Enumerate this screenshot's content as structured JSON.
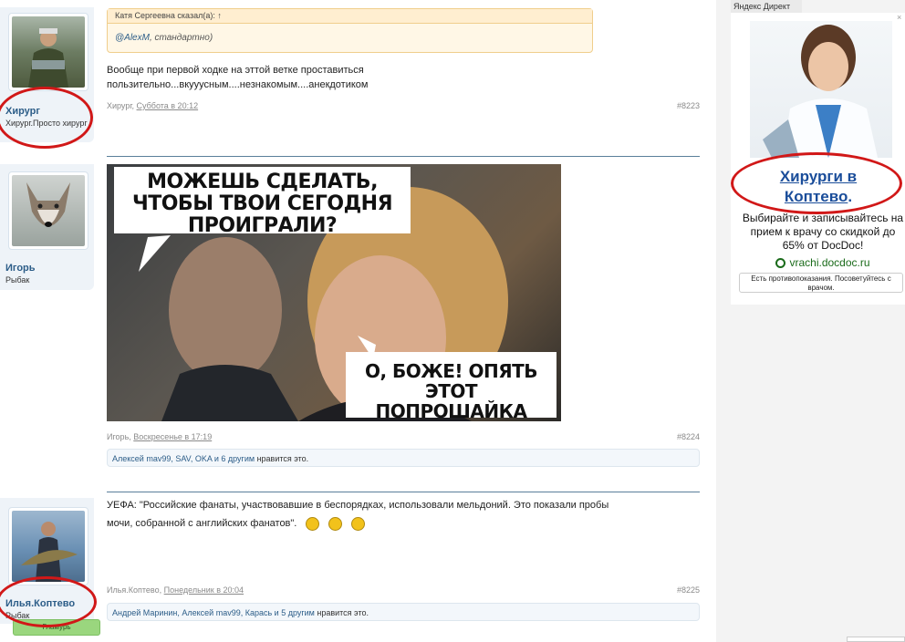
{
  "posts": [
    {
      "user": "Хирург",
      "user_title": "Хирург.Просто хирург",
      "quote_author": "Катя Сергеевна сказал(а): ↑",
      "quote_mention": "@AlexM",
      "quote_text": ", стандартно)",
      "message_line1": "Вообще при первой ходке на эттой ветке проставиться",
      "message_line2": "пользительно...вкууусным....незнакомым....анекдотиком",
      "meta_author": "Хирург, ",
      "meta_time": "Суббота в 20:12",
      "number": "#8223"
    },
    {
      "user": "Игорь",
      "user_title": "Рыбак",
      "meme_top": "МОЖЕШЬ СДЕЛАТЬ, ЧТОБЫ ТВОИ СЕГОДНЯ ПРОИГРАЛИ?",
      "meme_bottom": "О, БОЖЕ! ОПЯТЬ ЭТОТ ПОПРОШАЙКА",
      "meta_author": "Игорь, ",
      "meta_time": "Воскресенье в 17:19",
      "number": "#8224",
      "likes_names": "Алексей mav99, SAV, OKA и 6 другим",
      "likes_suffix": " нравится это."
    },
    {
      "user": "Илья.Коптево",
      "user_title": "Рыбак",
      "badge": "Гламурь",
      "message_line1": "УЕФА: \"Российские фанаты, участвовавшие в беспорядках, использовали мельдоний. Это показали пробы",
      "message_line2": "мочи, собранной с английских фанатов\".",
      "meta_author": "Илья.Коптево, ",
      "meta_time": "Понедельник в 20:04",
      "number": "#8225",
      "likes_names": "Андрей Маринин, Алексей mav99, Карась и 5 другим",
      "likes_suffix": " нравится это."
    }
  ],
  "ad": {
    "label": "Яндекс Директ",
    "title": "Хирурги в Коптево.",
    "title_link": "Хирурги",
    "title_rest": " в",
    "title_line2": "Коптево",
    "description": "Выбирайте и записывайтесь на прием к врачу со скидкой до 65% от DocDoc!",
    "domain": "vrachi.docdoc.ru",
    "warning": "Есть противопоказания. Посоветуйтесь с врачом."
  },
  "colors": {
    "accent": "#2c5d88",
    "highlight_circle": "#d11818",
    "ad_link": "#1a4d9a"
  }
}
